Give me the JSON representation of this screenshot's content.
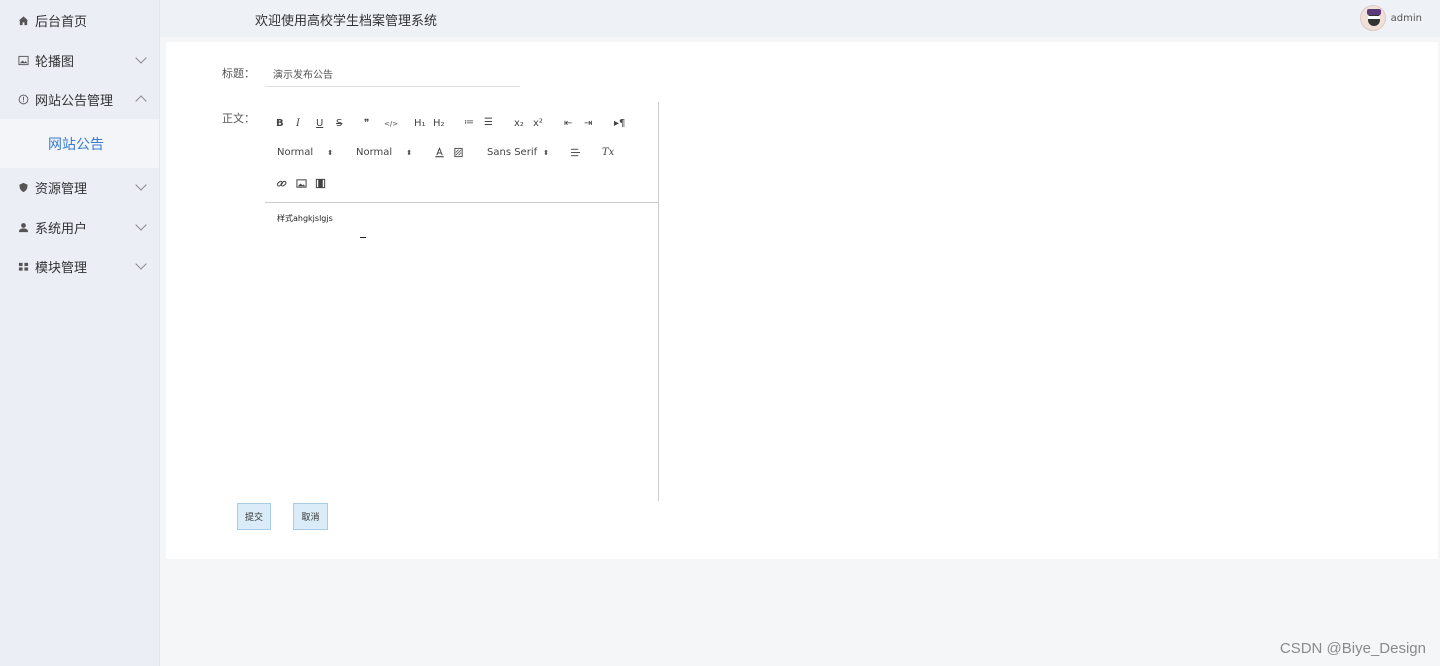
{
  "sidebar": {
    "items": [
      {
        "label": "后台首页",
        "icon": "home-icon"
      },
      {
        "label": "轮播图",
        "icon": "image-icon"
      },
      {
        "label": "网站公告管理",
        "icon": "info-circle-icon"
      },
      {
        "label": "资源管理",
        "icon": "shield-icon"
      },
      {
        "label": "系统用户",
        "icon": "user-icon"
      },
      {
        "label": "模块管理",
        "icon": "grid-icon"
      }
    ],
    "submenu": [
      {
        "label": "网站公告"
      }
    ]
  },
  "header": {
    "welcome": "欢迎使用高校学生档案管理系统",
    "username": "admin"
  },
  "form": {
    "title_label": "标题：",
    "title_value": "演示发布公告",
    "content_label": "正文：",
    "content_value": "样式ahgkjslgjs",
    "submit_label": "提交",
    "cancel_label": "取消"
  },
  "toolbar": {
    "bold": "B",
    "italic": "I",
    "underline": "U",
    "strike": "S",
    "blockquote": "❞",
    "code": "</>",
    "h1": "H₁",
    "h2": "H₂",
    "ordered_list": "≔",
    "bullet_list": "☰",
    "subscript": "x₂",
    "superscript": "x²",
    "outdent": "⇤",
    "indent": "⇥",
    "direction": "▸¶",
    "size_select": "Normal",
    "header_select": "Normal",
    "font_select": "Sans Serif",
    "clean": "Tx"
  },
  "watermark": "CSDN @Biye_Design"
}
